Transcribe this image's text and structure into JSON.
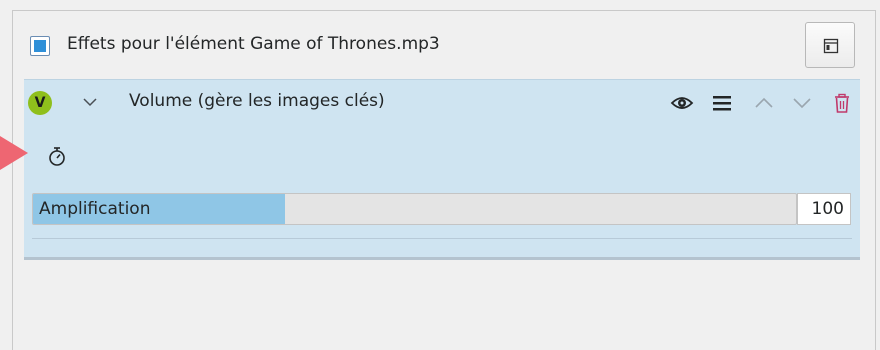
{
  "header": {
    "title": "Effets pour l'élément Game of Thrones.mp3",
    "checkbox_checked": true,
    "layout_button_icon": "layout-icon"
  },
  "effect": {
    "badge": "V",
    "badge_color": "#8fbf1c",
    "name": "Volume (gère les images clés)",
    "toolbar_icons": [
      "eye-icon",
      "hamburger-menu-icon",
      "move-up-icon",
      "move-down-icon",
      "trash-icon"
    ],
    "keyframe_icon": "stopwatch-icon",
    "parameter": {
      "label": "Amplification",
      "value": "100",
      "fill_fraction": 0.33
    }
  },
  "colors": {
    "panel_bg": "#cfe4f1",
    "slider_fill": "#8fc6e6",
    "accent_checkbox": "#2e8fd8",
    "delete_icon": "#c0396b",
    "annotation_arrow": "#ee6672"
  }
}
